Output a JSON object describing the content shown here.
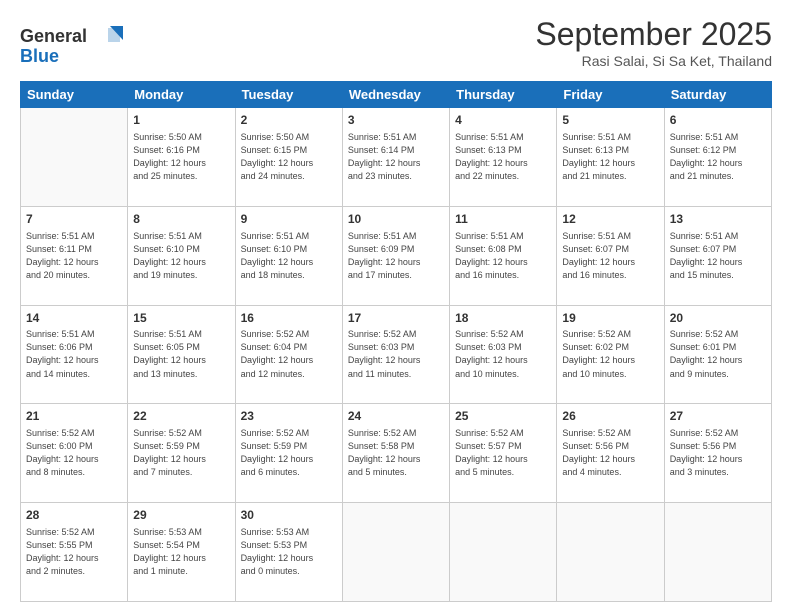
{
  "logo": {
    "general": "General",
    "blue": "Blue"
  },
  "header": {
    "month": "September 2025",
    "location": "Rasi Salai, Si Sa Ket, Thailand"
  },
  "weekdays": [
    "Sunday",
    "Monday",
    "Tuesday",
    "Wednesday",
    "Thursday",
    "Friday",
    "Saturday"
  ],
  "weeks": [
    [
      {
        "day": "",
        "info": ""
      },
      {
        "day": "1",
        "info": "Sunrise: 5:50 AM\nSunset: 6:16 PM\nDaylight: 12 hours\nand 25 minutes."
      },
      {
        "day": "2",
        "info": "Sunrise: 5:50 AM\nSunset: 6:15 PM\nDaylight: 12 hours\nand 24 minutes."
      },
      {
        "day": "3",
        "info": "Sunrise: 5:51 AM\nSunset: 6:14 PM\nDaylight: 12 hours\nand 23 minutes."
      },
      {
        "day": "4",
        "info": "Sunrise: 5:51 AM\nSunset: 6:13 PM\nDaylight: 12 hours\nand 22 minutes."
      },
      {
        "day": "5",
        "info": "Sunrise: 5:51 AM\nSunset: 6:13 PM\nDaylight: 12 hours\nand 21 minutes."
      },
      {
        "day": "6",
        "info": "Sunrise: 5:51 AM\nSunset: 6:12 PM\nDaylight: 12 hours\nand 21 minutes."
      }
    ],
    [
      {
        "day": "7",
        "info": "Sunrise: 5:51 AM\nSunset: 6:11 PM\nDaylight: 12 hours\nand 20 minutes."
      },
      {
        "day": "8",
        "info": "Sunrise: 5:51 AM\nSunset: 6:10 PM\nDaylight: 12 hours\nand 19 minutes."
      },
      {
        "day": "9",
        "info": "Sunrise: 5:51 AM\nSunset: 6:10 PM\nDaylight: 12 hours\nand 18 minutes."
      },
      {
        "day": "10",
        "info": "Sunrise: 5:51 AM\nSunset: 6:09 PM\nDaylight: 12 hours\nand 17 minutes."
      },
      {
        "day": "11",
        "info": "Sunrise: 5:51 AM\nSunset: 6:08 PM\nDaylight: 12 hours\nand 16 minutes."
      },
      {
        "day": "12",
        "info": "Sunrise: 5:51 AM\nSunset: 6:07 PM\nDaylight: 12 hours\nand 16 minutes."
      },
      {
        "day": "13",
        "info": "Sunrise: 5:51 AM\nSunset: 6:07 PM\nDaylight: 12 hours\nand 15 minutes."
      }
    ],
    [
      {
        "day": "14",
        "info": "Sunrise: 5:51 AM\nSunset: 6:06 PM\nDaylight: 12 hours\nand 14 minutes."
      },
      {
        "day": "15",
        "info": "Sunrise: 5:51 AM\nSunset: 6:05 PM\nDaylight: 12 hours\nand 13 minutes."
      },
      {
        "day": "16",
        "info": "Sunrise: 5:52 AM\nSunset: 6:04 PM\nDaylight: 12 hours\nand 12 minutes."
      },
      {
        "day": "17",
        "info": "Sunrise: 5:52 AM\nSunset: 6:03 PM\nDaylight: 12 hours\nand 11 minutes."
      },
      {
        "day": "18",
        "info": "Sunrise: 5:52 AM\nSunset: 6:03 PM\nDaylight: 12 hours\nand 10 minutes."
      },
      {
        "day": "19",
        "info": "Sunrise: 5:52 AM\nSunset: 6:02 PM\nDaylight: 12 hours\nand 10 minutes."
      },
      {
        "day": "20",
        "info": "Sunrise: 5:52 AM\nSunset: 6:01 PM\nDaylight: 12 hours\nand 9 minutes."
      }
    ],
    [
      {
        "day": "21",
        "info": "Sunrise: 5:52 AM\nSunset: 6:00 PM\nDaylight: 12 hours\nand 8 minutes."
      },
      {
        "day": "22",
        "info": "Sunrise: 5:52 AM\nSunset: 5:59 PM\nDaylight: 12 hours\nand 7 minutes."
      },
      {
        "day": "23",
        "info": "Sunrise: 5:52 AM\nSunset: 5:59 PM\nDaylight: 12 hours\nand 6 minutes."
      },
      {
        "day": "24",
        "info": "Sunrise: 5:52 AM\nSunset: 5:58 PM\nDaylight: 12 hours\nand 5 minutes."
      },
      {
        "day": "25",
        "info": "Sunrise: 5:52 AM\nSunset: 5:57 PM\nDaylight: 12 hours\nand 5 minutes."
      },
      {
        "day": "26",
        "info": "Sunrise: 5:52 AM\nSunset: 5:56 PM\nDaylight: 12 hours\nand 4 minutes."
      },
      {
        "day": "27",
        "info": "Sunrise: 5:52 AM\nSunset: 5:56 PM\nDaylight: 12 hours\nand 3 minutes."
      }
    ],
    [
      {
        "day": "28",
        "info": "Sunrise: 5:52 AM\nSunset: 5:55 PM\nDaylight: 12 hours\nand 2 minutes."
      },
      {
        "day": "29",
        "info": "Sunrise: 5:53 AM\nSunset: 5:54 PM\nDaylight: 12 hours\nand 1 minute."
      },
      {
        "day": "30",
        "info": "Sunrise: 5:53 AM\nSunset: 5:53 PM\nDaylight: 12 hours\nand 0 minutes."
      },
      {
        "day": "",
        "info": ""
      },
      {
        "day": "",
        "info": ""
      },
      {
        "day": "",
        "info": ""
      },
      {
        "day": "",
        "info": ""
      }
    ]
  ]
}
